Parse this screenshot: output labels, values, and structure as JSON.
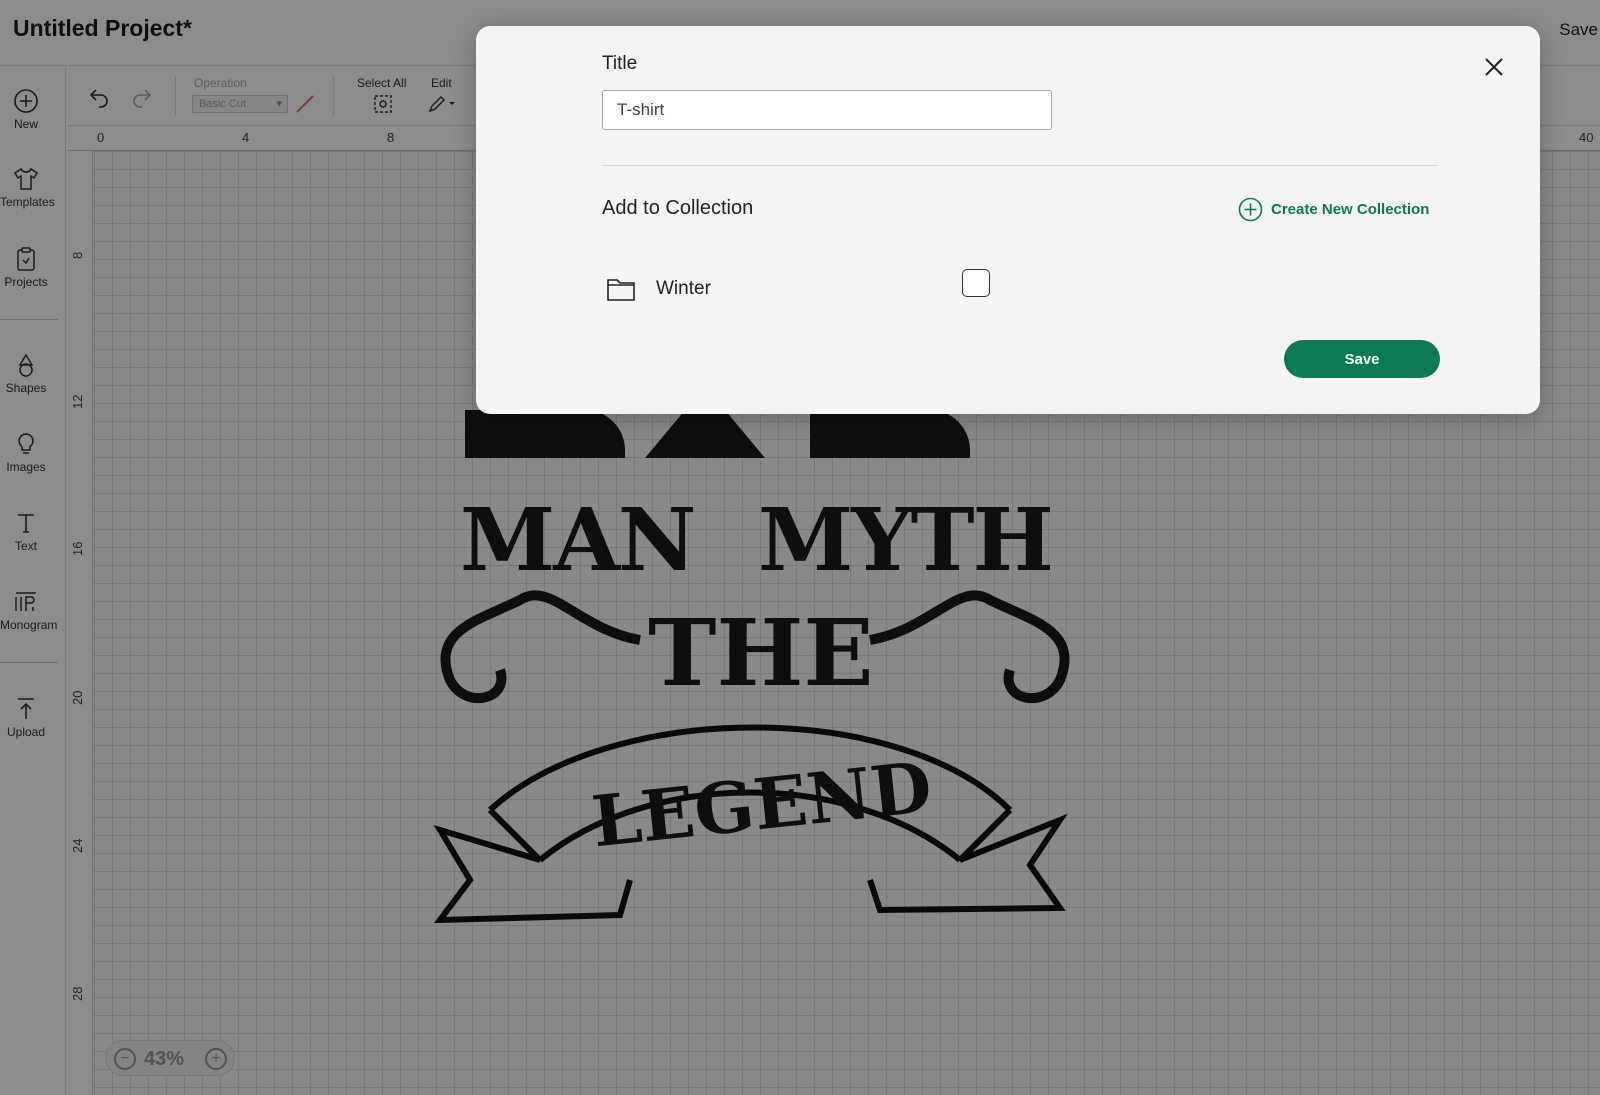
{
  "app": {
    "project_title": "Untitled Project*",
    "top_save_label": "Save"
  },
  "sidebar": {
    "items": [
      {
        "label": "New",
        "icon": "plus-circle-icon"
      },
      {
        "label": "Templates",
        "icon": "tshirt-icon"
      },
      {
        "label": "Projects",
        "icon": "clipboard-icon"
      },
      {
        "label": "Shapes",
        "icon": "shapes-icon"
      },
      {
        "label": "Images",
        "icon": "lightbulb-icon"
      },
      {
        "label": "Text",
        "icon": "text-icon"
      },
      {
        "label": "Monogram",
        "icon": "monogram-icon"
      },
      {
        "label": "Upload",
        "icon": "upload-icon"
      }
    ]
  },
  "toolbar": {
    "operation_label": "Operation",
    "operation_value": "Basic Cut",
    "select_all_label": "Select All",
    "edit_label": "Edit"
  },
  "ruler": {
    "top_ticks": [
      "0",
      "4",
      "8",
      "40"
    ],
    "left_ticks": [
      "8",
      "12",
      "16",
      "20",
      "24",
      "28"
    ]
  },
  "zoom": {
    "value": "43%"
  },
  "dialog": {
    "title_label": "Title",
    "title_value": "T-shirt",
    "add_to_collection_label": "Add to Collection",
    "create_new_collection_label": "Create New Collection",
    "collections": [
      {
        "name": "Winter",
        "checked": false
      }
    ],
    "save_label": "Save",
    "accent_color": "#0b7a55"
  }
}
